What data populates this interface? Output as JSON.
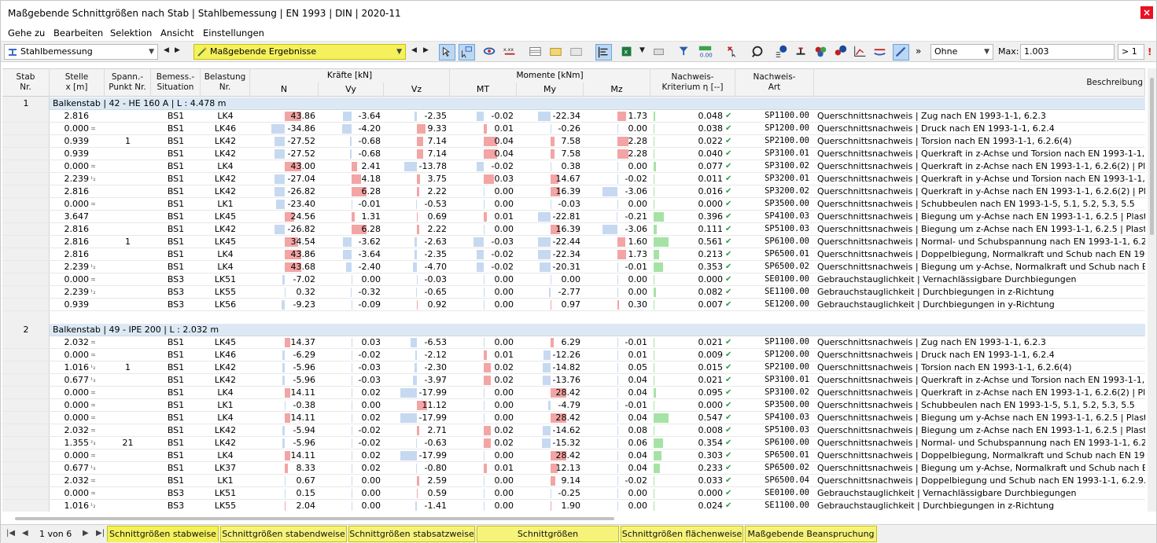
{
  "window": {
    "title": "Maßgebende Schnittgrößen nach Stab | Stahlbemessung | EN 1993 | DIN | 2020-11",
    "close": "×"
  },
  "menu": [
    "Gehe zu",
    "Bearbeiten",
    "Selektion",
    "Ansicht",
    "Einstellungen"
  ],
  "toolbar": {
    "module": "Stahlbemessung",
    "result": "Maßgebende Ergebnisse",
    "filter": "Ohne",
    "max_label": "Max:",
    "max_value": "1.003",
    "gt_label": "> 1",
    "overflow": "»"
  },
  "headers": {
    "stab": "Stab\nNr.",
    "stelle": "Stelle\nx [m]",
    "spann": "Spann.-\nPunkt Nr.",
    "bemess": "Bemess.-\nSituation",
    "belastung": "Belastung\nNr.",
    "kraefte": "Kräfte [kN]",
    "momente": "Momente [kNm]",
    "N": "N",
    "Vy": "Vy",
    "Vz": "Vz",
    "MT": "MT",
    "My": "My",
    "Mz": "Mz",
    "kriterium": "Nachweis-\nKriterium η [--]",
    "art": "Nachweis-\nArt",
    "beschreibung": "Beschreibung"
  },
  "sections": [
    {
      "nr": "1",
      "label": "Balkenstab | 42 - HE 160 A | L : 4.478 m",
      "rows": [
        [
          "2.816",
          "",
          "",
          "BS1",
          "LK4",
          "43.86",
          "-3.64",
          "-2.35",
          "-0.02",
          "-22.34",
          "1.73",
          "0.048",
          "SP1100.00",
          "Querschnittsnachweis | Zug nach EN 1993-1-1, 6.2.3"
        ],
        [
          "0.000",
          "≍",
          "",
          "BS1",
          "LK46",
          "-34.86",
          "-4.20",
          "9.33",
          "0.01",
          "-0.26",
          "0.00",
          "0.038",
          "SP1200.00",
          "Querschnittsnachweis | Druck nach EN 1993-1-1, 6.2.4"
        ],
        [
          "0.939",
          "",
          "1",
          "BS1",
          "LK42",
          "-27.52",
          "-0.68",
          "7.14",
          "0.04",
          "7.58",
          "2.28",
          "0.022",
          "SP2100.00",
          "Querschnittsnachweis | Torsion nach EN 1993-1-1, 6.2.6(4)"
        ],
        [
          "0.939",
          "",
          "",
          "BS1",
          "LK42",
          "-27.52",
          "-0.68",
          "7.14",
          "0.04",
          "7.58",
          "2.28",
          "0.040",
          "SP3100.01",
          "Querschnittsnachweis | Querkraft in z-Achse und Torsion nach EN 1993-1-1, 6.2.7"
        ],
        [
          "0.000",
          "≍",
          "",
          "BS1",
          "LK4",
          "43.00",
          "2.41",
          "-13.78",
          "-0.02",
          "0.38",
          "0.00",
          "0.077",
          "SP3100.02",
          "Querschnittsnachweis | Querkraft in z-Achse nach EN 1993-1-1, 6.2.6(2) | Plastisch"
        ],
        [
          "2.239",
          "¹₂",
          "",
          "BS1",
          "LK42",
          "-27.04",
          "4.18",
          "3.75",
          "0.03",
          "14.67",
          "-0.02",
          "0.011",
          "SP3200.01",
          "Querschnittsnachweis | Querkraft in y-Achse und Torsion nach EN 1993-1-1, 6.2.7"
        ],
        [
          "2.816",
          "",
          "",
          "BS1",
          "LK42",
          "-26.82",
          "6.28",
          "2.22",
          "0.00",
          "16.39",
          "-3.06",
          "0.016",
          "SP3200.02",
          "Querschnittsnachweis | Querkraft in y-Achse nach EN 1993-1-1, 6.2.6(2) | Plastisch"
        ],
        [
          "0.000",
          "≍",
          "",
          "BS1",
          "LK1",
          "-23.40",
          "-0.01",
          "-0.53",
          "0.00",
          "-0.03",
          "0.00",
          "0.000",
          "SP3500.00",
          "Querschnittsnachweis | Schubbeulen nach EN 1993-1-5, 5.1, 5.2, 5.3, 5.5"
        ],
        [
          "3.647",
          "",
          "",
          "BS1",
          "LK45",
          "24.56",
          "1.31",
          "0.69",
          "0.01",
          "-22.81",
          "-0.21",
          "0.396",
          "SP4100.03",
          "Querschnittsnachweis | Biegung um y-Achse nach EN 1993-1-1, 6.2.5 | Plastische"
        ],
        [
          "2.816",
          "",
          "",
          "BS1",
          "LK42",
          "-26.82",
          "6.28",
          "2.22",
          "0.00",
          "16.39",
          "-3.06",
          "0.111",
          "SP5100.03",
          "Querschnittsnachweis | Biegung um z-Achse nach EN 1993-1-1, 6.2.5 | Plastische"
        ],
        [
          "2.816",
          "",
          "1",
          "BS1",
          "LK45",
          "34.54",
          "-3.62",
          "-2.63",
          "-0.03",
          "-22.44",
          "1.60",
          "0.561",
          "SP6100.00",
          "Querschnittsnachweis | Normal- und Schubspannung nach EN 1993-1-1, 6.2.1(5)"
        ],
        [
          "2.816",
          "",
          "",
          "BS1",
          "LK4",
          "43.86",
          "-3.64",
          "-2.35",
          "-0.02",
          "-22.34",
          "1.73",
          "0.213",
          "SP6500.01",
          "Querschnittsnachweis | Doppelbiegung, Normalkraft und Schub nach EN 1993-1"
        ],
        [
          "2.239",
          "¹₂",
          "",
          "BS1",
          "LK4",
          "43.68",
          "-2.40",
          "-4.70",
          "-0.02",
          "-20.31",
          "-0.01",
          "0.353",
          "SP6500.02",
          "Querschnittsnachweis | Biegung um y-Achse, Normalkraft und Schub nach EN 19"
        ],
        [
          "0.000",
          "≍",
          "",
          "BS3",
          "LK51",
          "-7.02",
          "0.00",
          "-0.03",
          "0.00",
          "0.00",
          "0.00",
          "0.000",
          "SE0100.00",
          "Gebrauchstauglichkeit | Vernachlässigbare Durchbiegungen"
        ],
        [
          "2.239",
          "¹₂",
          "",
          "BS3",
          "LK55",
          "0.32",
          "-0.32",
          "-0.65",
          "0.00",
          "-2.77",
          "0.00",
          "0.082",
          "SE1100.00",
          "Gebrauchstauglichkeit | Durchbiegungen in z-Richtung"
        ],
        [
          "0.939",
          "",
          "",
          "BS3",
          "LK56",
          "-9.23",
          "-0.09",
          "0.92",
          "0.00",
          "0.97",
          "0.30",
          "0.007",
          "SE1200.00",
          "Gebrauchstauglichkeit | Durchbiegungen in y-Richtung"
        ]
      ]
    },
    {
      "nr": "2",
      "label": "Balkenstab | 49 - IPE 200 | L : 2.032 m",
      "rows": [
        [
          "2.032",
          "≍",
          "",
          "BS1",
          "LK45",
          "14.37",
          "0.03",
          "-6.53",
          "0.00",
          "6.29",
          "-0.01",
          "0.021",
          "SP1100.00",
          "Querschnittsnachweis | Zug nach EN 1993-1-1, 6.2.3"
        ],
        [
          "0.000",
          "≍",
          "",
          "BS1",
          "LK46",
          "-6.29",
          "-0.02",
          "-2.12",
          "0.01",
          "-12.26",
          "0.01",
          "0.009",
          "SP1200.00",
          "Querschnittsnachweis | Druck nach EN 1993-1-1, 6.2.4"
        ],
        [
          "1.016",
          "¹₂",
          "1",
          "BS1",
          "LK42",
          "-5.96",
          "-0.03",
          "-2.30",
          "0.02",
          "-14.82",
          "0.05",
          "0.015",
          "SP2100.00",
          "Querschnittsnachweis | Torsion nach EN 1993-1-1, 6.2.6(4)"
        ],
        [
          "0.677",
          "¹₃",
          "",
          "BS1",
          "LK42",
          "-5.96",
          "-0.03",
          "-3.97",
          "0.02",
          "-13.76",
          "0.04",
          "0.021",
          "SP3100.01",
          "Querschnittsnachweis | Querkraft in z-Achse und Torsion nach EN 1993-1-1, 6.2.7"
        ],
        [
          "0.000",
          "≍",
          "",
          "BS1",
          "LK4",
          "14.11",
          "0.02",
          "-17.99",
          "0.00",
          "28.42",
          "0.04",
          "0.095",
          "SP3100.02",
          "Querschnittsnachweis | Querkraft in z-Achse nach EN 1993-1-1, 6.2.6(2) | Plastisch"
        ],
        [
          "0.000",
          "≍",
          "",
          "BS1",
          "LK1",
          "-0.38",
          "0.00",
          "11.12",
          "0.00",
          "-4.79",
          "-0.01",
          "0.000",
          "SP3500.00",
          "Querschnittsnachweis | Schubbeulen nach EN 1993-1-5, 5.1, 5.2, 5.3, 5.5"
        ],
        [
          "0.000",
          "≍",
          "",
          "BS1",
          "LK4",
          "14.11",
          "0.02",
          "-17.99",
          "0.00",
          "28.42",
          "0.04",
          "0.547",
          "SP4100.03",
          "Querschnittsnachweis | Biegung um y-Achse nach EN 1993-1-1, 6.2.5 | Plastische"
        ],
        [
          "2.032",
          "≍",
          "",
          "BS1",
          "LK42",
          "-5.94",
          "-0.02",
          "2.71",
          "0.02",
          "-14.62",
          "0.08",
          "0.008",
          "SP5100.03",
          "Querschnittsnachweis | Biegung um z-Achse nach EN 1993-1-1, 6.2.5 | Plastische"
        ],
        [
          "1.355",
          "²₃",
          "21",
          "BS1",
          "LK42",
          "-5.96",
          "-0.02",
          "-0.63",
          "0.02",
          "-15.32",
          "0.06",
          "0.354",
          "SP6100.00",
          "Querschnittsnachweis | Normal- und Schubspannung nach EN 1993-1-1, 6.2.1(5)"
        ],
        [
          "0.000",
          "≍",
          "",
          "BS1",
          "LK4",
          "14.11",
          "0.02",
          "-17.99",
          "0.00",
          "28.42",
          "0.04",
          "0.303",
          "SP6500.01",
          "Querschnittsnachweis | Doppelbiegung, Normalkraft und Schub nach EN 1993-1"
        ],
        [
          "0.677",
          "¹₃",
          "",
          "BS1",
          "LK37",
          "8.33",
          "0.02",
          "-0.80",
          "0.01",
          "12.13",
          "0.04",
          "0.233",
          "SP6500.02",
          "Querschnittsnachweis | Biegung um y-Achse, Normalkraft und Schub nach EN 19"
        ],
        [
          "2.032",
          "≍",
          "",
          "BS1",
          "LK1",
          "0.67",
          "0.00",
          "2.59",
          "0.00",
          "9.14",
          "-0.02",
          "0.033",
          "SP6500.04",
          "Querschnittsnachweis | Doppelbiegung und Schub nach EN 1993-1-1, 6.2.9.1, 6.2"
        ],
        [
          "0.000",
          "≍",
          "",
          "BS3",
          "LK51",
          "0.15",
          "0.00",
          "0.59",
          "0.00",
          "-0.25",
          "0.00",
          "0.000",
          "SE0100.00",
          "Gebrauchstauglichkeit | Vernachlässigbare Durchbiegungen"
        ],
        [
          "1.016",
          "¹₂",
          "",
          "BS3",
          "LK55",
          "2.04",
          "0.00",
          "-1.41",
          "0.00",
          "1.90",
          "0.00",
          "0.024",
          "SE1100.00",
          "Gebrauchstauglichkeit | Durchbiegungen in z-Richtung"
        ]
      ]
    }
  ],
  "pager": {
    "label": "1 von 6"
  },
  "tabs": [
    "Schnittgrößen stabweise",
    "Schnittgrößen stabendweise",
    "Schnittgrößen stabsatzweise",
    "Schnittgrößen stabsatzendweise",
    "Schnittgrößen flächenweise",
    "Maßgebende Beanspruchung"
  ],
  "colors": {
    "accent_yellow": "#f4f15c",
    "positive_bar": "#f3a4a4",
    "negative_bar": "#c6d9f1",
    "ratio_bar": "#a5e3a5",
    "section_bg": "#dce9f5"
  }
}
